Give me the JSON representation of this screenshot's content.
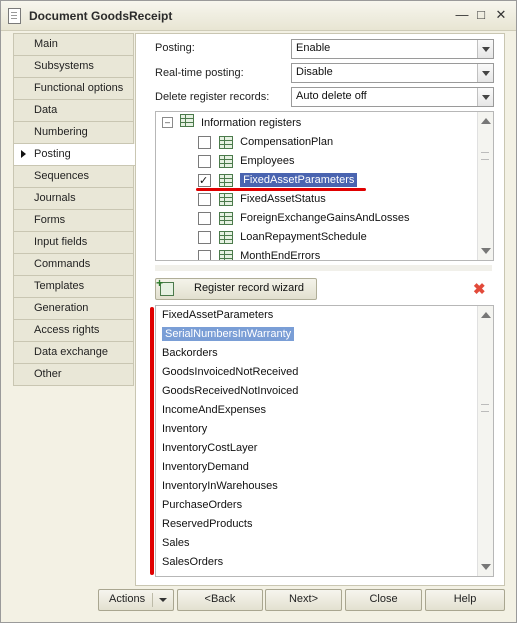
{
  "window": {
    "title": "Document GoodsReceipt"
  },
  "sidebar": {
    "items": [
      {
        "label": "Main"
      },
      {
        "label": "Subsystems"
      },
      {
        "label": "Functional options"
      },
      {
        "label": "Data"
      },
      {
        "label": "Numbering"
      },
      {
        "label": "Posting",
        "active": true
      },
      {
        "label": "Sequences"
      },
      {
        "label": "Journals"
      },
      {
        "label": "Forms"
      },
      {
        "label": "Input fields"
      },
      {
        "label": "Commands"
      },
      {
        "label": "Templates"
      },
      {
        "label": "Generation"
      },
      {
        "label": "Access rights"
      },
      {
        "label": "Data exchange"
      },
      {
        "label": "Other"
      }
    ]
  },
  "fields": {
    "posting": {
      "label": "Posting:",
      "value": "Enable"
    },
    "realtime": {
      "label": "Real-time posting:",
      "value": "Disable"
    },
    "delete_records": {
      "label": "Delete register records:",
      "value": "Auto delete off"
    }
  },
  "tree": {
    "root": "Information registers",
    "items": [
      {
        "label": "CompensationPlan",
        "checked": false
      },
      {
        "label": "Employees",
        "checked": false
      },
      {
        "label": "FixedAssetParameters",
        "checked": true
      },
      {
        "label": "FixedAssetStatus",
        "checked": false
      },
      {
        "label": "ForeignExchangeGainsAndLosses",
        "checked": false
      },
      {
        "label": "LoanRepaymentSchedule",
        "checked": false
      },
      {
        "label": "MonthEndErrors",
        "checked": false
      }
    ]
  },
  "wizard": {
    "label": "Register record wizard"
  },
  "records": {
    "items": [
      "FixedAssetParameters",
      "SerialNumbersInWarranty",
      "Backorders",
      "GoodsInvoicedNotReceived",
      "GoodsReceivedNotInvoiced",
      "IncomeAndExpenses",
      "Inventory",
      "InventoryCostLayer",
      "InventoryDemand",
      "InventoryInWarehouses",
      "PurchaseOrders",
      "ReservedProducts",
      "Sales",
      "SalesOrders"
    ]
  },
  "buttons": {
    "actions": "Actions",
    "back": "<Back",
    "next": "Next>",
    "close": "Close",
    "help": "Help"
  },
  "colors": {
    "selection": "#4a64b0",
    "highlight": "#e00000"
  }
}
